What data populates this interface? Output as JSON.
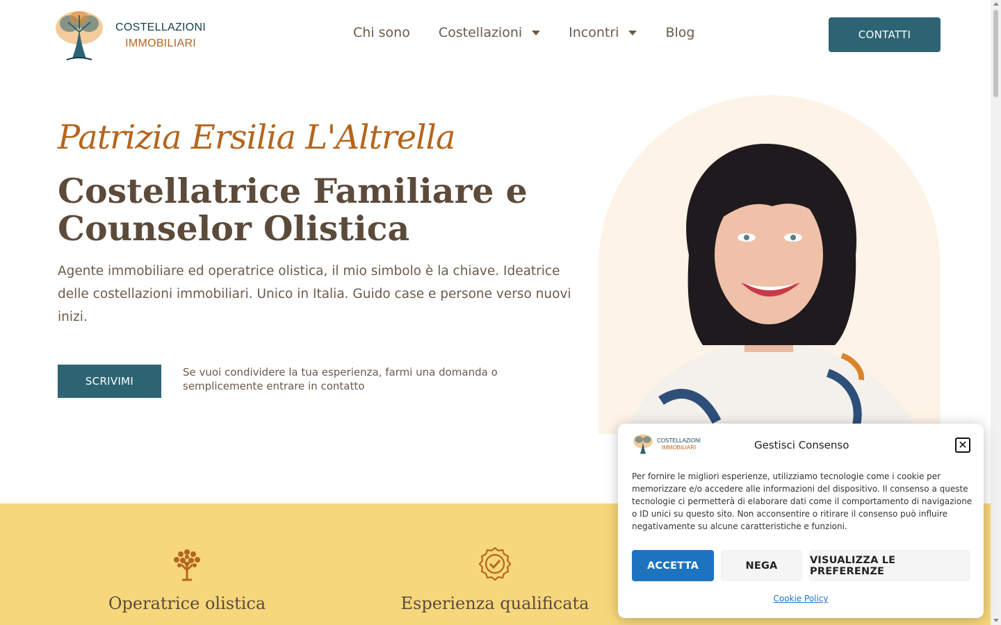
{
  "brand": {
    "line1": "COSTELLAZIONI",
    "line2": "IMMOBILIARI",
    "logo_icon": "tree-of-life-icon",
    "colors": {
      "primary": "#2d6473",
      "accent": "#b5651d",
      "text": "#6b5a4a",
      "band": "#f7d77b"
    }
  },
  "nav": {
    "items": [
      {
        "label": "Chi sono",
        "has_dropdown": false
      },
      {
        "label": "Costellazioni",
        "has_dropdown": true
      },
      {
        "label": "Incontri",
        "has_dropdown": true
      },
      {
        "label": "Blog",
        "has_dropdown": false
      }
    ],
    "cta_label": "CONTATTI"
  },
  "hero": {
    "name": "Patrizia Ersilia L'Altrella",
    "headline": "Costellatrice Familiare e Counselor Olistica",
    "intro": "Agente immobiliare ed operatrice olistica, il mio simbolo è la chiave. Ideatrice delle costellazioni immobiliari. Unico in Italia. Guido case e persone verso nuovi inizi.",
    "button_label": "SCRIVIMI",
    "button_note": "Se vuoi condividere la tua esperienza, farmi una domanda o semplicemente entrare in contatto"
  },
  "features": [
    {
      "icon": "tree-icon",
      "title": "Operatrice olistica"
    },
    {
      "icon": "badge-check-icon",
      "title": "Esperienza qualificata"
    }
  ],
  "cookie": {
    "title": "Gestisci Consenso",
    "close_icon": "close-icon",
    "text": "Per fornire le migliori esperienze, utilizziamo tecnologie come i cookie per memorizzare e/o accedere alle informazioni del dispositivo. Il consenso a queste tecnologie ci permetterà di elaborare dati come il comportamento di navigazione o ID unici su questo sito. Non acconsentire o ritirare il consenso può influire negativamente su alcune caratteristiche e funzioni.",
    "accept_label": "ACCETTA",
    "deny_label": "NEGA",
    "prefs_label": "VISUALIZZA LE PREFERENZE",
    "policy_label": "Cookie Policy",
    "logo_line1": "COSTELLAZIONI",
    "logo_line2": "IMMOBILIARI"
  }
}
